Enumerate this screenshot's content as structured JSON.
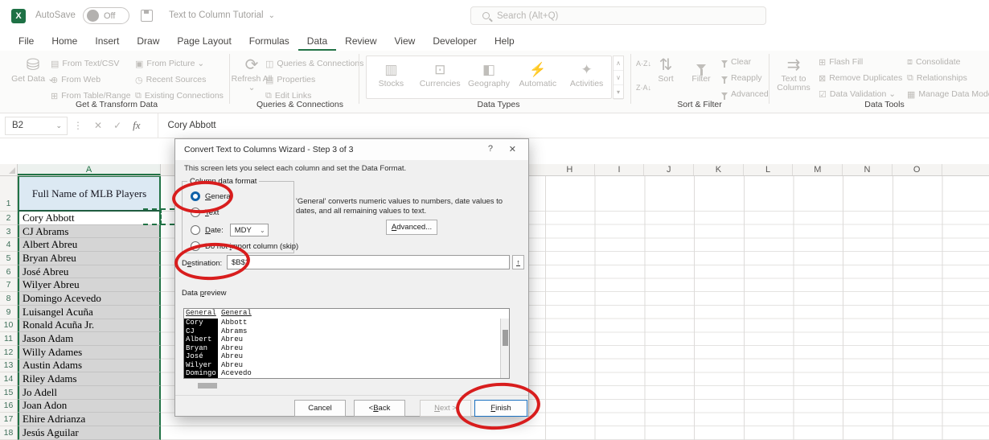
{
  "titlebar": {
    "logo": "X",
    "autosave_label": "AutoSave",
    "autosave_state": "Off",
    "doc_title": "Text to Column Tutorial",
    "search_placeholder": "Search (Alt+Q)"
  },
  "menu": {
    "tabs": [
      "File",
      "Home",
      "Insert",
      "Draw",
      "Page Layout",
      "Formulas",
      "Data",
      "Review",
      "View",
      "Developer",
      "Help"
    ],
    "active_tab": "Data"
  },
  "ribbon": {
    "groups": [
      {
        "label": "Get & Transform Data",
        "big": "Get Data",
        "items": [
          "From Text/CSV",
          "From Web",
          "From Table/Range",
          "From Picture",
          "Recent Sources",
          "Existing Connections"
        ]
      },
      {
        "label": "Queries & Connections",
        "big": "Refresh All",
        "items": [
          "Queries & Connections",
          "Properties",
          "Edit Links"
        ]
      },
      {
        "label": "Data Types",
        "items": [
          "Stocks",
          "Currencies",
          "Geography",
          "Automatic",
          "Activities"
        ]
      },
      {
        "label": "Sort & Filter",
        "bigs": [
          "Sort",
          "Filter"
        ],
        "items": [
          "Clear",
          "Reapply",
          "Advanced"
        ]
      },
      {
        "label": "Data Tools",
        "big": "Text to Columns",
        "items": [
          "Flash Fill",
          "Remove Duplicates",
          "Data Validation",
          "Consolidate",
          "Relationships",
          "Manage Data Model"
        ]
      }
    ]
  },
  "formula_bar": {
    "name_box": "B2",
    "content": "Cory Abbott"
  },
  "grid": {
    "col_a": "A",
    "cols_right": [
      "H",
      "I",
      "J",
      "K",
      "L",
      "M",
      "N",
      "O"
    ],
    "a1_header": "Full Name of MLB Players",
    "players": [
      "Cory Abbott",
      "CJ Abrams",
      "Albert Abreu",
      "Bryan Abreu",
      "José Abreu",
      "Wilyer Abreu",
      "Domingo Acevedo",
      "Luisangel Acuña",
      "Ronald Acuña Jr.",
      "Jason Adam",
      "Willy Adames",
      "Austin Adams",
      "Riley Adams",
      "Jo Adell",
      "Joan Adon",
      "Ehire Adrianza",
      "Jesús Aguilar"
    ],
    "first_row_number": 2
  },
  "dialog": {
    "title": "Convert Text to Columns Wizard - Step 3 of 3",
    "subtitle": "This screen lets you select each column and set the Data Format.",
    "format_group_label": "Column data format",
    "radio_general": "General",
    "radio_text": "Text",
    "radio_date": "Date:",
    "date_format": "MDY",
    "radio_skip": "Do not import column (skip)",
    "general_hint": "'General' converts numeric values to numbers, date values to dates, and all remaining values to text.",
    "advanced_label": "Advanced...",
    "destination_label": "Destination:",
    "destination_value": "$B$2",
    "preview_label": "Data preview",
    "preview_headers": [
      "General",
      "General"
    ],
    "preview_rows": [
      [
        "Cory",
        "Abbott"
      ],
      [
        "CJ",
        "Abrams"
      ],
      [
        "Albert",
        "Abreu"
      ],
      [
        "Bryan",
        "Abreu"
      ],
      [
        "José",
        "Abreu"
      ],
      [
        "Wilyer",
        "Abreu"
      ],
      [
        "Domingo",
        "Acevedo"
      ]
    ],
    "cancel_label": "Cancel",
    "back_label": "< Back",
    "next_label": "Next >",
    "finish_label": "Finish",
    "help_glyph": "?",
    "close_glyph": "✕"
  },
  "icons": {
    "chevron": "⌄",
    "more": "⋮",
    "cancel": "✕",
    "check": "✓",
    "fx": "fx",
    "get_data": "⛁",
    "from_text": "▤",
    "from_web": "⊕",
    "from_table": "⊞",
    "from_picture": "▣",
    "recent_sources": "◷",
    "existing_conn": "⧉",
    "refresh": "⟳",
    "queries": "◫",
    "properties": "▤",
    "edit_links": "⧉",
    "stocks": "▥",
    "currencies": "⊡",
    "geography": "◧",
    "automatic": "⚡",
    "activities": "✦",
    "sort_az": "A·Z↓",
    "sort_za": "Z·A↓",
    "sort_big": "⇅",
    "text_to_columns": "⇉",
    "flash_fill": "⊞",
    "remove_dup": "⊠",
    "data_validation": "☑",
    "consolidate": "⧈",
    "relationships": "⧉",
    "manage_model": "▦",
    "scroll_up": "∧",
    "scroll_down": "∨",
    "scroll_more": "▾",
    "range_picker": "↑"
  }
}
